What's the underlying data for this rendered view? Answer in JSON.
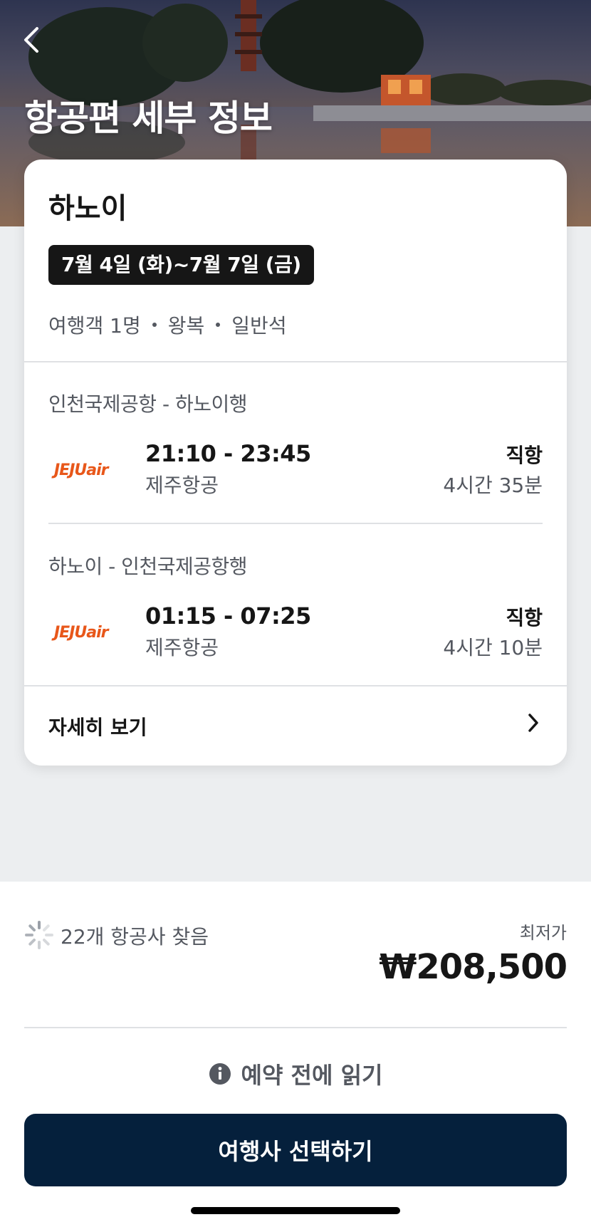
{
  "header": {
    "title": "항공편 세부 정보",
    "back_icon": "chevron-left-icon"
  },
  "trip": {
    "city": "하노이",
    "dates": "7월 4일 (화)~7월 7일 (금)",
    "travelers": "여행객 1명",
    "trip_type": "왕복",
    "cabin": "일반석"
  },
  "legs": [
    {
      "route": "인천국제공항 - 하노이행",
      "logo": "JEJUair",
      "time": "21:10 - 23:45",
      "airline": "제주항공",
      "stops": "직항",
      "duration": "4시간 35분"
    },
    {
      "route": "하노이 - 인천국제공항행",
      "logo": "JEJUair",
      "time": "01:15 - 07:25",
      "airline": "제주항공",
      "stops": "직항",
      "duration": "4시간 10분"
    }
  ],
  "details": {
    "label": "자세히 보기",
    "icon": "chevron-right-icon"
  },
  "summary": {
    "airlines_found": "22개 항공사 찾음",
    "lowest_label": "최저가",
    "price": "₩208,500",
    "read_before": "예약 전에 읽기",
    "read_icon": "info-icon",
    "select_button": "여행사 선택하기"
  },
  "colors": {
    "primary_button": "#05203c",
    "jeju_orange": "#e8571a"
  }
}
